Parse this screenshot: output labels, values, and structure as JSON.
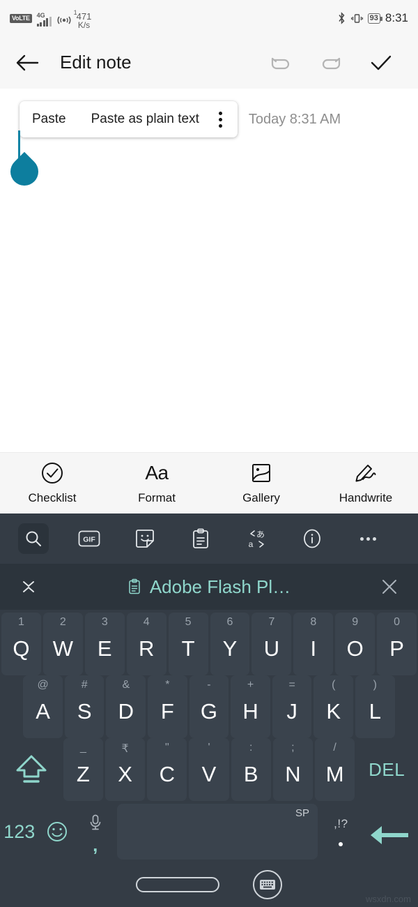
{
  "status_bar": {
    "volte_label": "VoLTE",
    "network_type": "4G",
    "hotspot_count": "1",
    "net_speed_value": "471",
    "net_speed_unit": "K/s",
    "bluetooth_icon": "bluetooth-icon",
    "vibrate_icon": "vibrate-icon",
    "battery_percent": "93",
    "time": "8:31"
  },
  "app_bar": {
    "back_icon": "back-arrow-icon",
    "title": "Edit note",
    "undo_icon": "undo-icon",
    "redo_icon": "redo-icon",
    "confirm_icon": "checkmark-icon"
  },
  "note": {
    "timestamp": "Today 8:31 AM",
    "body_text": "",
    "cursor_handle": "text-cursor-handle",
    "paste_menu": {
      "paste_label": "Paste",
      "paste_plain_label": "Paste as plain text",
      "overflow_icon": "kebab-menu-icon"
    }
  },
  "format_bar": {
    "items": [
      {
        "label": "Checklist",
        "icon": "check-circle-icon"
      },
      {
        "label": "Format",
        "icon": "font-size-icon",
        "glyph": "Aa"
      },
      {
        "label": "Gallery",
        "icon": "image-icon"
      },
      {
        "label": "Handwrite",
        "icon": "pen-icon"
      }
    ]
  },
  "keyboard": {
    "toolbar": [
      {
        "name": "search-icon",
        "label": ""
      },
      {
        "name": "gif-icon",
        "label": "GIF"
      },
      {
        "name": "sticker-icon",
        "label": ""
      },
      {
        "name": "clipboard-icon",
        "label": ""
      },
      {
        "name": "translate-icon",
        "label": ""
      },
      {
        "name": "info-icon",
        "label": ""
      },
      {
        "name": "more-icon",
        "label": ""
      }
    ],
    "clipboard_suggestion": {
      "collapse_icon": "collapse-chevron-icon",
      "clip_icon": "clipboard-icon",
      "text": "Adobe Flash Pl…",
      "close_icon": "close-icon"
    },
    "row1": [
      {
        "main": "Q",
        "sub": "1"
      },
      {
        "main": "W",
        "sub": "2"
      },
      {
        "main": "E",
        "sub": "3"
      },
      {
        "main": "R",
        "sub": "4"
      },
      {
        "main": "T",
        "sub": "5"
      },
      {
        "main": "Y",
        "sub": "6"
      },
      {
        "main": "U",
        "sub": "7"
      },
      {
        "main": "I",
        "sub": "8"
      },
      {
        "main": "O",
        "sub": "9"
      },
      {
        "main": "P",
        "sub": "0"
      }
    ],
    "row2": [
      {
        "main": "A",
        "sub": "@"
      },
      {
        "main": "S",
        "sub": "#"
      },
      {
        "main": "D",
        "sub": "&"
      },
      {
        "main": "F",
        "sub": "*"
      },
      {
        "main": "G",
        "sub": "-"
      },
      {
        "main": "H",
        "sub": "+"
      },
      {
        "main": "J",
        "sub": "="
      },
      {
        "main": "K",
        "sub": "("
      },
      {
        "main": "L",
        "sub": ")"
      }
    ],
    "row3": {
      "shift_icon": "shift-icon",
      "keys": [
        {
          "main": "Z",
          "sub": "_"
        },
        {
          "main": "X",
          "sub": "₹"
        },
        {
          "main": "C",
          "sub": "\""
        },
        {
          "main": "V",
          "sub": "'"
        },
        {
          "main": "B",
          "sub": ":"
        },
        {
          "main": "N",
          "sub": ";"
        },
        {
          "main": "M",
          "sub": "/"
        }
      ],
      "delete_label": "DEL"
    },
    "row4": {
      "numeric_label": "123",
      "emoji_icon": "emoji-icon",
      "mic_icon": "microphone-icon",
      "comma_label": ",",
      "space_label": "SP",
      "period_sub": ",!?",
      "period_label": ".",
      "enter_icon": "enter-icon"
    }
  },
  "nav_bar": {
    "home_icon": "home-pill-icon",
    "hide_keyboard_icon": "hide-keyboard-icon"
  },
  "watermark": "wsxdn.com",
  "colors": {
    "accent_teal": "#8fd6cb",
    "cursor_blue": "#0d7e9e",
    "keyboard_bg": "#343c45",
    "key_bg": "#3a434d",
    "app_bg": "#f7f7f7"
  }
}
